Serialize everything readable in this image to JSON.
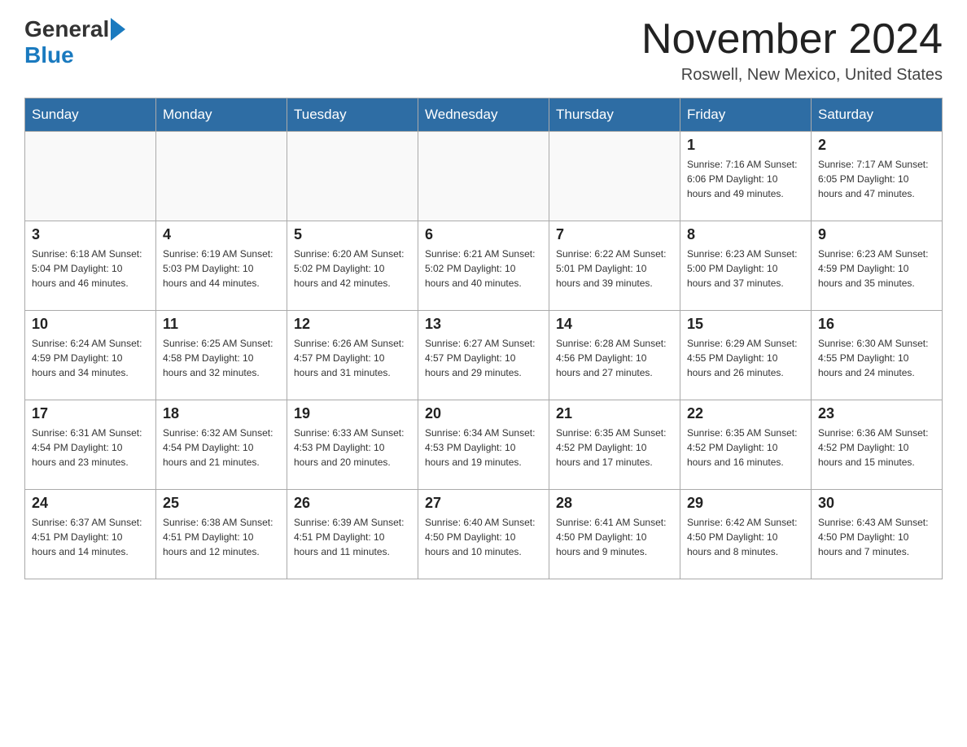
{
  "header": {
    "logo_general": "General",
    "logo_blue": "Blue",
    "month_title": "November 2024",
    "location": "Roswell, New Mexico, United States"
  },
  "days_of_week": [
    "Sunday",
    "Monday",
    "Tuesday",
    "Wednesday",
    "Thursday",
    "Friday",
    "Saturday"
  ],
  "weeks": [
    [
      {
        "day": "",
        "info": ""
      },
      {
        "day": "",
        "info": ""
      },
      {
        "day": "",
        "info": ""
      },
      {
        "day": "",
        "info": ""
      },
      {
        "day": "",
        "info": ""
      },
      {
        "day": "1",
        "info": "Sunrise: 7:16 AM\nSunset: 6:06 PM\nDaylight: 10 hours and 49 minutes."
      },
      {
        "day": "2",
        "info": "Sunrise: 7:17 AM\nSunset: 6:05 PM\nDaylight: 10 hours and 47 minutes."
      }
    ],
    [
      {
        "day": "3",
        "info": "Sunrise: 6:18 AM\nSunset: 5:04 PM\nDaylight: 10 hours and 46 minutes."
      },
      {
        "day": "4",
        "info": "Sunrise: 6:19 AM\nSunset: 5:03 PM\nDaylight: 10 hours and 44 minutes."
      },
      {
        "day": "5",
        "info": "Sunrise: 6:20 AM\nSunset: 5:02 PM\nDaylight: 10 hours and 42 minutes."
      },
      {
        "day": "6",
        "info": "Sunrise: 6:21 AM\nSunset: 5:02 PM\nDaylight: 10 hours and 40 minutes."
      },
      {
        "day": "7",
        "info": "Sunrise: 6:22 AM\nSunset: 5:01 PM\nDaylight: 10 hours and 39 minutes."
      },
      {
        "day": "8",
        "info": "Sunrise: 6:23 AM\nSunset: 5:00 PM\nDaylight: 10 hours and 37 minutes."
      },
      {
        "day": "9",
        "info": "Sunrise: 6:23 AM\nSunset: 4:59 PM\nDaylight: 10 hours and 35 minutes."
      }
    ],
    [
      {
        "day": "10",
        "info": "Sunrise: 6:24 AM\nSunset: 4:59 PM\nDaylight: 10 hours and 34 minutes."
      },
      {
        "day": "11",
        "info": "Sunrise: 6:25 AM\nSunset: 4:58 PM\nDaylight: 10 hours and 32 minutes."
      },
      {
        "day": "12",
        "info": "Sunrise: 6:26 AM\nSunset: 4:57 PM\nDaylight: 10 hours and 31 minutes."
      },
      {
        "day": "13",
        "info": "Sunrise: 6:27 AM\nSunset: 4:57 PM\nDaylight: 10 hours and 29 minutes."
      },
      {
        "day": "14",
        "info": "Sunrise: 6:28 AM\nSunset: 4:56 PM\nDaylight: 10 hours and 27 minutes."
      },
      {
        "day": "15",
        "info": "Sunrise: 6:29 AM\nSunset: 4:55 PM\nDaylight: 10 hours and 26 minutes."
      },
      {
        "day": "16",
        "info": "Sunrise: 6:30 AM\nSunset: 4:55 PM\nDaylight: 10 hours and 24 minutes."
      }
    ],
    [
      {
        "day": "17",
        "info": "Sunrise: 6:31 AM\nSunset: 4:54 PM\nDaylight: 10 hours and 23 minutes."
      },
      {
        "day": "18",
        "info": "Sunrise: 6:32 AM\nSunset: 4:54 PM\nDaylight: 10 hours and 21 minutes."
      },
      {
        "day": "19",
        "info": "Sunrise: 6:33 AM\nSunset: 4:53 PM\nDaylight: 10 hours and 20 minutes."
      },
      {
        "day": "20",
        "info": "Sunrise: 6:34 AM\nSunset: 4:53 PM\nDaylight: 10 hours and 19 minutes."
      },
      {
        "day": "21",
        "info": "Sunrise: 6:35 AM\nSunset: 4:52 PM\nDaylight: 10 hours and 17 minutes."
      },
      {
        "day": "22",
        "info": "Sunrise: 6:35 AM\nSunset: 4:52 PM\nDaylight: 10 hours and 16 minutes."
      },
      {
        "day": "23",
        "info": "Sunrise: 6:36 AM\nSunset: 4:52 PM\nDaylight: 10 hours and 15 minutes."
      }
    ],
    [
      {
        "day": "24",
        "info": "Sunrise: 6:37 AM\nSunset: 4:51 PM\nDaylight: 10 hours and 14 minutes."
      },
      {
        "day": "25",
        "info": "Sunrise: 6:38 AM\nSunset: 4:51 PM\nDaylight: 10 hours and 12 minutes."
      },
      {
        "day": "26",
        "info": "Sunrise: 6:39 AM\nSunset: 4:51 PM\nDaylight: 10 hours and 11 minutes."
      },
      {
        "day": "27",
        "info": "Sunrise: 6:40 AM\nSunset: 4:50 PM\nDaylight: 10 hours and 10 minutes."
      },
      {
        "day": "28",
        "info": "Sunrise: 6:41 AM\nSunset: 4:50 PM\nDaylight: 10 hours and 9 minutes."
      },
      {
        "day": "29",
        "info": "Sunrise: 6:42 AM\nSunset: 4:50 PM\nDaylight: 10 hours and 8 minutes."
      },
      {
        "day": "30",
        "info": "Sunrise: 6:43 AM\nSunset: 4:50 PM\nDaylight: 10 hours and 7 minutes."
      }
    ]
  ]
}
